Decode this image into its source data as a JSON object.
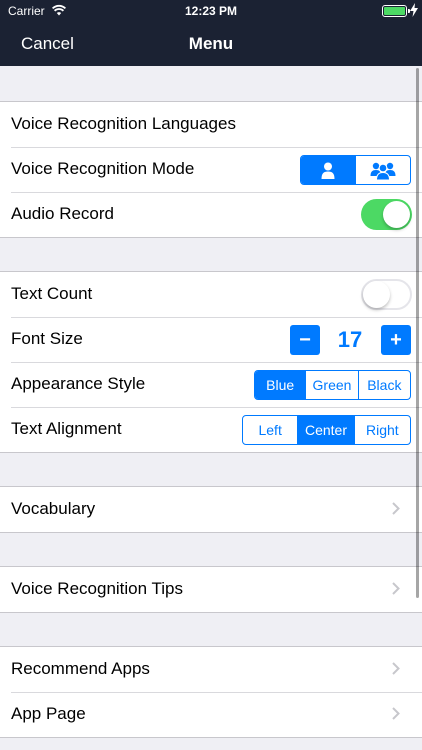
{
  "status": {
    "carrier": "Carrier",
    "time": "12:23 PM"
  },
  "nav": {
    "cancel": "Cancel",
    "title": "Menu"
  },
  "voice": {
    "languages": "Voice Recognition Languages",
    "mode": "Voice Recognition Mode",
    "mode_selected": "single-user",
    "audio_record": "Audio Record",
    "audio_record_on": true
  },
  "text": {
    "count": "Text Count",
    "count_on": false,
    "font_size_label": "Font Size",
    "font_size_value": "17",
    "font_minus": "−",
    "font_plus": "+",
    "appearance_label": "Appearance Style",
    "appearance_options": [
      "Blue",
      "Green",
      "Black"
    ],
    "appearance_selected": "Blue",
    "alignment_label": "Text Alignment",
    "alignment_options": [
      "Left",
      "Center",
      "Right"
    ],
    "alignment_selected": "Center"
  },
  "vocabulary": "Vocabulary",
  "tips": "Voice Recognition Tips",
  "more": {
    "recommend": "Recommend Apps",
    "app_page": "App Page"
  },
  "colors": {
    "accent": "#007aff",
    "nav_bg": "#1b2233",
    "switch_on": "#4cd964",
    "background": "#efeff4"
  }
}
